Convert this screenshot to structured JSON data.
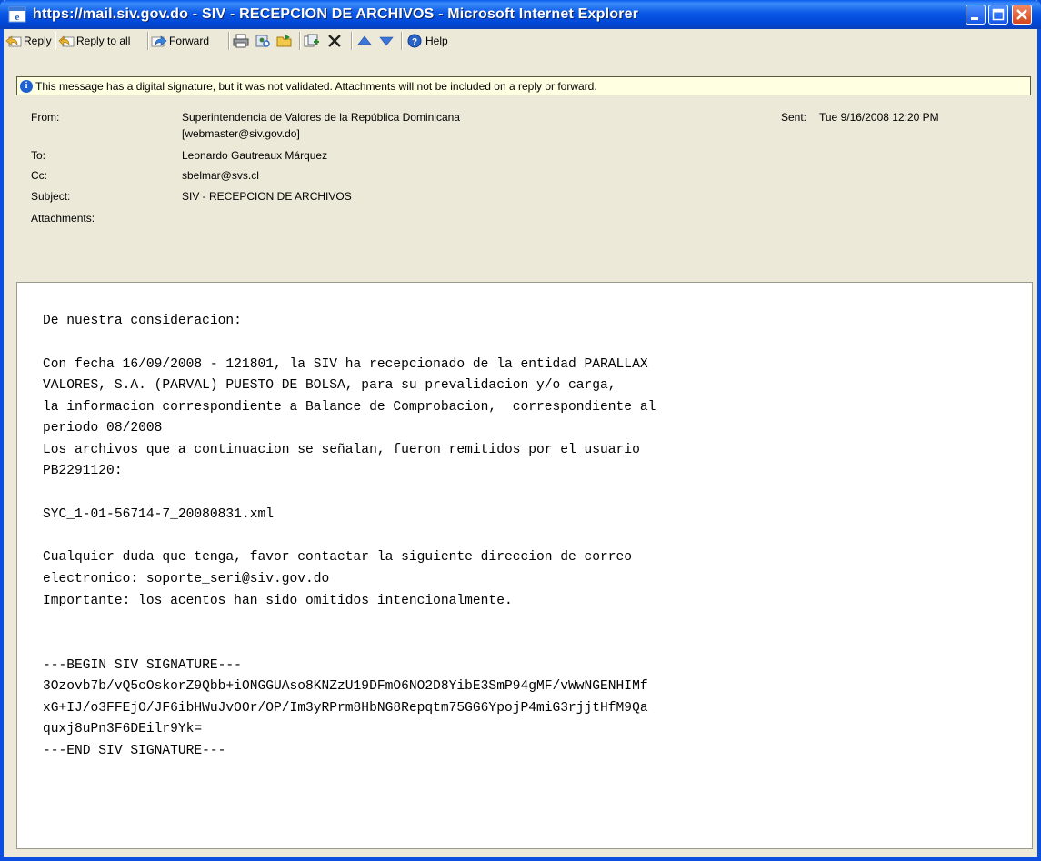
{
  "window": {
    "title": "https://mail.siv.gov.do - SIV - RECEPCION DE ARCHIVOS - Microsoft Internet Explorer"
  },
  "toolbar": {
    "reply_label": "Reply",
    "reply_all_label": "Reply to all",
    "forward_label": "Forward",
    "help_label": "Help"
  },
  "infobar": {
    "text": "This message has a digital signature, but it was not validated. Attachments will not be included on a reply or forward."
  },
  "header": {
    "from_label": "From:",
    "from_name": "Superintendencia de Valores de la República Dominicana",
    "from_email": "[webmaster@siv.gov.do]",
    "sent_label": "Sent:",
    "sent_value": "Tue 9/16/2008 12:20 PM",
    "to_label": "To:",
    "to_value": "Leonardo Gautreaux Márquez",
    "cc_label": "Cc:",
    "cc_value": "sbelmar@svs.cl",
    "subject_label": "Subject:",
    "subject_value": "SIV - RECEPCION DE ARCHIVOS",
    "attachments_label": "Attachments:"
  },
  "body": {
    "line1": "De nuestra consideracion:",
    "para1_l1": "Con fecha 16/09/2008 - 121801, la SIV ha recepcionado de la entidad PARALLAX",
    "para1_l2": "VALORES, S.A. (PARVAL) PUESTO DE BOLSA, para su prevalidacion y/o carga,",
    "para1_l3": "la informacion correspondiente a Balance de Comprobacion,  correspondiente al",
    "para1_l4": "periodo 08/2008",
    "para1_l5": "Los archivos que a continuacion se señalan, fueron remitidos por el usuario",
    "para1_l6": "PB2291120:",
    "filename": "SYC_1-01-56714-7_20080831.xml",
    "contact_l1": "Cualquier duda que tenga, favor contactar la siguiente direccion de correo",
    "contact_l2": "electronico: soporte_seri@siv.gov.do",
    "contact_l3": "Importante: los acentos han sido omitidos intencionalmente.",
    "sig_begin": "---BEGIN SIV SIGNATURE---",
    "sig_l1": "3Ozovb7b/vQ5cOskorZ9Qbb+iONGGUAso8KNZzU19DFmO6NO2D8YibE3SmP94gMF/vWwNGENHIMf",
    "sig_l2": "xG+IJ/o3FFEjO/JF6ibHWuJvOOr/OP/Im3yRPrm8HbNG8Repqtm75GG6YpojP4miG3rjjtHfM9Qa",
    "sig_l3": "quxj8uPn3F6DEilr9Yk=",
    "sig_end": "---END SIV SIGNATURE---"
  }
}
